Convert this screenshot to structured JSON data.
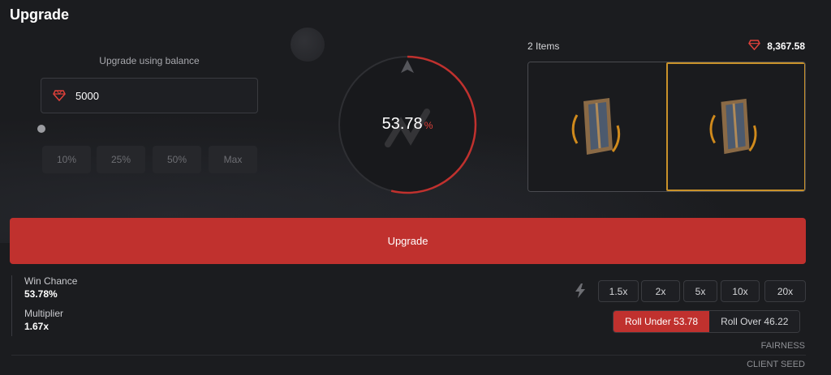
{
  "page": {
    "title": "Upgrade"
  },
  "left": {
    "balance_label": "Upgrade using balance",
    "amount_value": "5000",
    "amount_placeholder": "",
    "slider_value_fraction": 0,
    "percent_buttons": [
      "10%",
      "25%",
      "50%",
      "Max"
    ]
  },
  "dial": {
    "value": "53.78",
    "unit": "%",
    "fill_fraction": 0.5378,
    "accent_color": "#e0413a"
  },
  "items": {
    "count_label": "2 Items",
    "total_value": "8,367.58",
    "slots": [
      {
        "icon": "item-shield-icon",
        "selected": false
      },
      {
        "icon": "item-shield-icon",
        "selected": true
      }
    ],
    "highlight_color": "#c9922a"
  },
  "actions": {
    "upgrade_label": "Upgrade",
    "upgrade_color": "#c0312e"
  },
  "stats": {
    "win_chance_label": "Win Chance",
    "win_chance_value": "53.78%",
    "multiplier_label": "Multiplier",
    "multiplier_value": "1.67x"
  },
  "multipliers": [
    "1.5x",
    "2x",
    "5x",
    "10x",
    "20x"
  ],
  "roll": {
    "under_label": "Roll Under 53.78",
    "over_label": "Roll Over 46.22",
    "active": "under"
  },
  "footer": {
    "fairness": "FAIRNESS",
    "client_seed": "CLIENT SEED"
  }
}
